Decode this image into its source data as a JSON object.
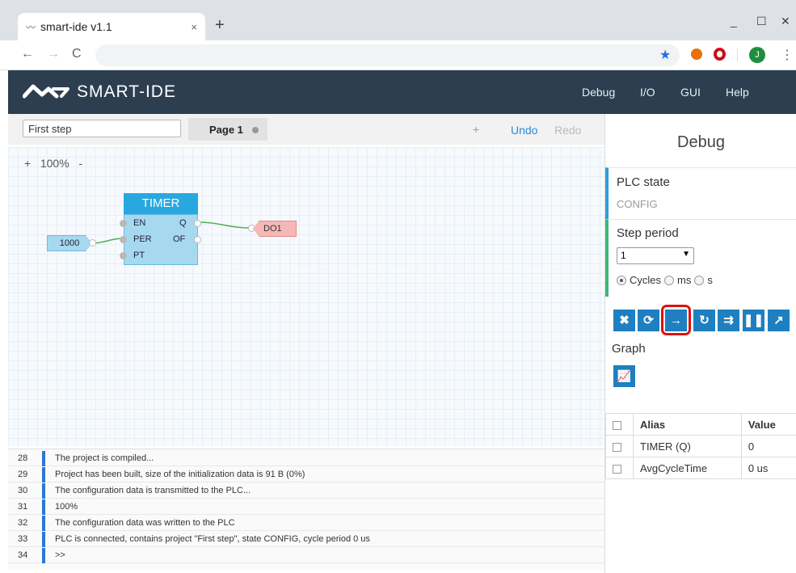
{
  "browser": {
    "tab_title": "smart-ide v1.1",
    "tab_close": "×",
    "new_tab": "+",
    "profile_initial": "J",
    "win_min": "_",
    "win_max": "☐",
    "win_close": "✕"
  },
  "app": {
    "brand": "SMART-IDE",
    "nav": [
      "Debug",
      "I/O",
      "GUI",
      "Help"
    ]
  },
  "editor": {
    "project_name": "First step",
    "page_tab": "Page 1",
    "add_label": "+",
    "undo_label": "Undo",
    "redo_label": "Redo",
    "zoom": {
      "plus": "+",
      "level": "100%",
      "minus": "-"
    }
  },
  "diagram": {
    "block_title": "TIMER",
    "inputs": [
      "EN",
      "PER",
      "PT"
    ],
    "outputs": [
      "Q",
      "OF"
    ],
    "constant": "1000",
    "output_tag": "DO1"
  },
  "console": {
    "lines": [
      {
        "num": "28",
        "text": "The project is compiled..."
      },
      {
        "num": "29",
        "text": "Project has been built, size of the initialization data is 91 B (0%)"
      },
      {
        "num": "30",
        "text": "The configuration data is transmitted to the PLC..."
      },
      {
        "num": "31",
        "text": "100%"
      },
      {
        "num": "32",
        "text": "The configuration data was written to the PLC"
      },
      {
        "num": "33",
        "text": "PLC is connected, contains project \"First step\", state CONFIG, cycle period 0 us"
      },
      {
        "num": "34",
        "text": ">>"
      }
    ]
  },
  "debug": {
    "title": "Debug",
    "plc_state_label": "PLC state",
    "plc_state_value": "CONFIG",
    "step_period_label": "Step period",
    "step_period_value": "1",
    "units": [
      "Cycles",
      "ms",
      "s"
    ],
    "selected_unit": "Cycles",
    "graph_label": "Graph",
    "table": {
      "headers": [
        "Alias",
        "Value"
      ],
      "rows": [
        {
          "alias": "TIMER (Q)",
          "value": "0"
        },
        {
          "alias": "AvgCycleTime",
          "value": "0 us"
        }
      ]
    }
  },
  "colors": {
    "appbar": "#2c3e50",
    "accent": "#1f7fc1",
    "highlight": "#e01010"
  }
}
